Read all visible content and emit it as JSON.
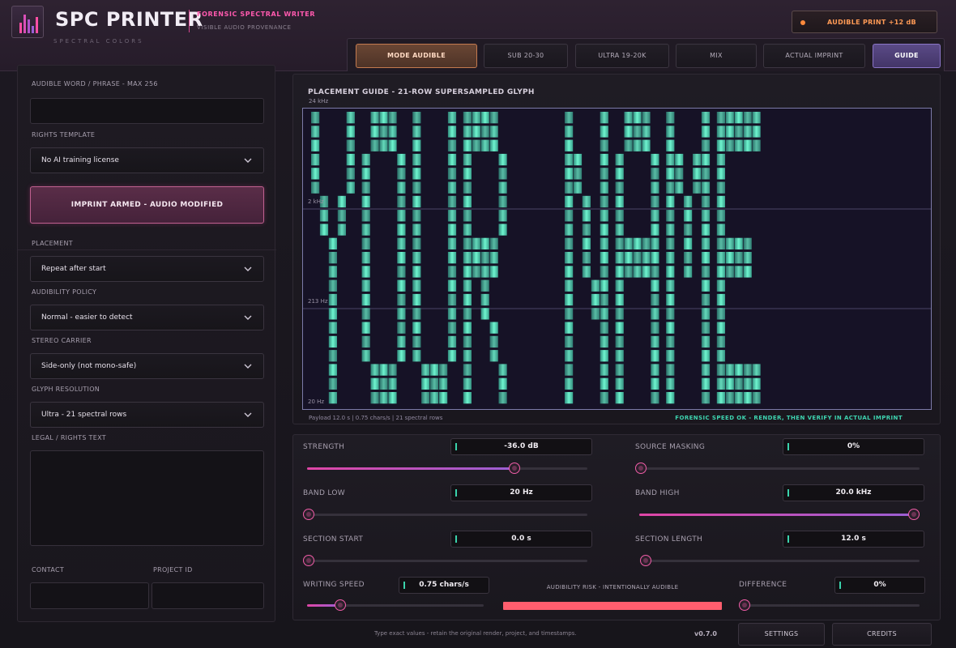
{
  "app": {
    "title": "SPC PRINTER",
    "subtitle": "SPECTRAL COLORS",
    "tagline": "FORENSIC SPECTRAL WRITER",
    "tagline2": "VISIBLE AUDIO PROVENANCE",
    "badge": "AUDIBLE PRINT +12 dB",
    "colors": {
      "accent_pink": "#ff4fa6",
      "glyph_teal": "#5cf2c8",
      "warning_orange": "#ff8a3c",
      "risk_red": "#ff5e6e"
    }
  },
  "tabs": [
    {
      "label": "MODE  AUDIBLE",
      "state": "active"
    },
    {
      "label": "SUB 20-30"
    },
    {
      "label": "ULTRA 19-20K"
    },
    {
      "label": "MIX"
    },
    {
      "label": "ACTUAL IMPRINT"
    },
    {
      "label": "GUIDE",
      "state": "selected"
    }
  ],
  "left": {
    "phrase_label": "AUDIBLE WORD / PHRASE - MAX 256",
    "phrase_value": "",
    "rights_label": "RIGHTS TEMPLATE",
    "rights_value": "No AI training license",
    "armed_button": "IMPRINT ARMED - AUDIO MODIFIED",
    "placement_label": "PLACEMENT",
    "placement_value": "Repeat after start",
    "audibility_label": "AUDIBILITY POLICY",
    "audibility_value": "Normal - easier to detect",
    "stereo_label": "STEREO CARRIER",
    "stereo_value": "Side-only (not mono-safe)",
    "glyph_label": "GLYPH RESOLUTION",
    "glyph_value": "Ultra - 21 spectral rows",
    "legal_label": "LEGAL / RIGHTS TEXT",
    "legal_value": "",
    "contact_label": "CONTACT",
    "contact_value": "",
    "project_label": "PROJECT ID",
    "project_value": ""
  },
  "guide": {
    "title": "PLACEMENT GUIDE - 21-ROW SUPERSAMPLED GLYPH",
    "glyph_text": "YOUR NAME",
    "freq_labels": [
      "24 kHz",
      "2 kHz",
      "213 Hz",
      "20 Hz"
    ],
    "footer": "Payload 12.0 s  |  0.75 chars/s  |  21 spectral rows",
    "status": "FORENSIC SPEED OK - RENDER, THEN VERIFY IN ACTUAL IMPRINT"
  },
  "controls": {
    "strength": {
      "label": "STRENGTH",
      "value": "-36.0 dB",
      "fraction": 0.74
    },
    "source_masking": {
      "label": "SOURCE MASKING",
      "value": "0%",
      "fraction": 0.0
    },
    "band_low": {
      "label": "BAND LOW",
      "value": "20 Hz",
      "fraction": 0.0
    },
    "band_high": {
      "label": "BAND HIGH",
      "value": "20.0 kHz",
      "fraction": 1.0
    },
    "section_start": {
      "label": "SECTION START",
      "value": "0.0 s",
      "fraction": 0.0
    },
    "section_length": {
      "label": "SECTION LENGTH",
      "value": "12.0 s",
      "fraction": 0.0
    },
    "writing_speed": {
      "label": "WRITING SPEED",
      "value": "0.75 chars/s",
      "fraction": 0.19
    },
    "difference": {
      "label": "DIFFERENCE",
      "value": "0%",
      "fraction": 0.0
    },
    "risk_label": "AUDIBILITY RISK - INTENTIONALLY AUDIBLE",
    "risk_level": 1.0
  },
  "footer": {
    "hint": "Type exact values - retain the original render, project, and timestamps.",
    "version": "v0.7.0",
    "settings": "SETTINGS",
    "credits": "CREDITS"
  }
}
